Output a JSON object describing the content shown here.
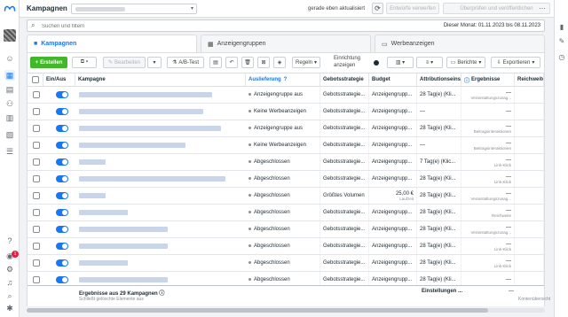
{
  "header": {
    "title": "Kampagnen",
    "update_status": "gerade eben aktualisiert",
    "discard_label": "Entwürfe verwerfen",
    "publish_label": "Überprüfen und veröffentlichen"
  },
  "search": {
    "placeholder": "Suchen und filtern",
    "date_range": "Dieser Monat: 01.11.2023 bis 08.11.2023"
  },
  "tabs": [
    {
      "label": "Kampagnen",
      "icon": "folder-icon",
      "active": true
    },
    {
      "label": "Anzeigengruppen",
      "icon": "grid-icon",
      "active": false
    },
    {
      "label": "Werbeanzeigen",
      "icon": "ad-icon",
      "active": false
    }
  ],
  "toolbar": {
    "create_label": "Erstellen",
    "edit_label": "Bearbeiten",
    "ab_test_label": "A/B-Test",
    "rules_label": "Regeln",
    "setup_label_line1": "Einrichtung",
    "setup_label_line2": "anzeigen",
    "reports_label": "Berichte",
    "export_label": "Exportieren"
  },
  "table": {
    "columns": [
      "Ein/Aus",
      "Kampagne",
      "Auslieferung",
      "Gebotsstrategie",
      "Budget",
      "Attributionseinstellung",
      "Ergebnisse",
      "Reichweite"
    ],
    "rows": [
      {
        "delivery": "Anzeigengruppe aus",
        "bid": "Gebotsstrategie...",
        "budget": "Anzeigengrupp...",
        "budget_sub": "",
        "attribution": "28 Tag(e) (Kli...",
        "results": "—",
        "results_sub": "Veranstaltungszusag..."
      },
      {
        "delivery": "Keine Werbeanzeigen",
        "bid": "Gebotsstrategie...",
        "budget": "Anzeigengrupp...",
        "budget_sub": "",
        "attribution": "—",
        "results": "—",
        "results_sub": ""
      },
      {
        "delivery": "Anzeigengruppe aus",
        "bid": "Gebotsstrategie...",
        "budget": "Anzeigengrupp...",
        "budget_sub": "",
        "attribution": "28 Tag(e) (Kli...",
        "results": "—",
        "results_sub": "Beitragsinteraktionen"
      },
      {
        "delivery": "Keine Werbeanzeigen",
        "bid": "Gebotsstrategie...",
        "budget": "Anzeigengrupp...",
        "budget_sub": "",
        "attribution": "—",
        "results": "—",
        "results_sub": "Beitragsinteraktionen"
      },
      {
        "delivery": "Abgeschlossen",
        "bid": "Gebotsstrategie...",
        "budget": "Anzeigengrupp...",
        "budget_sub": "",
        "attribution": "7 Tag(e) (Klic...",
        "results": "—",
        "results_sub": "Link-Klick"
      },
      {
        "delivery": "Abgeschlossen",
        "bid": "Gebotsstrategie...",
        "budget": "Anzeigengrupp...",
        "budget_sub": "",
        "attribution": "28 Tag(e) (Kli...",
        "results": "—",
        "results_sub": "Link-Klick"
      },
      {
        "delivery": "Abgeschlossen",
        "bid": "Größtes Volumen",
        "budget": "25,00 €",
        "budget_sub": "Laufzeit",
        "attribution": "28 Tag(e) (Kli...",
        "results": "—",
        "results_sub": "Veranstaltungszusag..."
      },
      {
        "delivery": "Abgeschlossen",
        "bid": "Gebotsstrategie...",
        "budget": "Anzeigengrupp...",
        "budget_sub": "",
        "attribution": "28 Tag(e) (Kli...",
        "results": "—",
        "results_sub": "Reichweite"
      },
      {
        "delivery": "Abgeschlossen",
        "bid": "Gebotsstrategie...",
        "budget": "Anzeigengrupp...",
        "budget_sub": "",
        "attribution": "28 Tag(e) (Kli...",
        "results": "—",
        "results_sub": "Veranstaltungszusag..."
      },
      {
        "delivery": "Abgeschlossen",
        "bid": "Gebotsstrategie...",
        "budget": "Anzeigengrupp...",
        "budget_sub": "",
        "attribution": "28 Tag(e) (Kli...",
        "results": "—",
        "results_sub": "Link-Klick"
      },
      {
        "delivery": "Abgeschlossen",
        "bid": "Gebotsstrategie...",
        "budget": "Anzeigengrupp...",
        "budget_sub": "",
        "attribution": "28 Tag(e) (Kli...",
        "results": "—",
        "results_sub": "Link-Klick"
      },
      {
        "delivery": "Abgeschlossen",
        "bid": "Gebotsstrategie...",
        "budget": "Anzeigengrupp...",
        "budget_sub": "",
        "attribution": "28 Tag(e) (Kli...",
        "results": "—",
        "results_sub": ""
      }
    ]
  },
  "footer": {
    "results_title": "Ergebnisse aus 29 Kampagnen",
    "results_sub": "Schließt gelöschte Elemente aus",
    "attribution": "Einstellungen ...",
    "dash": "—",
    "account_label": "Kontenübersicht"
  },
  "notifications": {
    "count": "1"
  },
  "colors": {
    "accent": "#1877f2",
    "create": "#42b72a",
    "badge": "#e41e3f"
  }
}
